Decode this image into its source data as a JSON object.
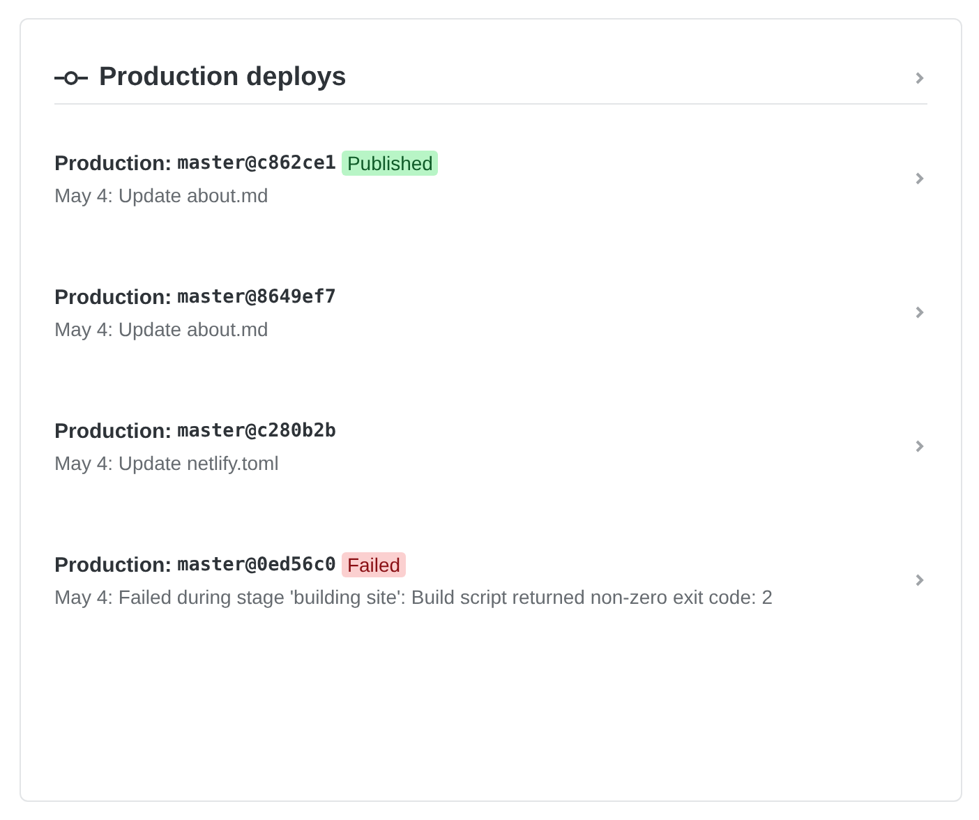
{
  "card": {
    "title": "Production deploys"
  },
  "deploys": [
    {
      "label": "Production:",
      "ref": "master@c862ce1",
      "badge": {
        "text": "Published",
        "kind": "success"
      },
      "description": "May 4: Update about.md"
    },
    {
      "label": "Production:",
      "ref": "master@8649ef7",
      "description": "May 4: Update about.md"
    },
    {
      "label": "Production:",
      "ref": "master@c280b2b",
      "description": "May 4: Update netlify.toml"
    },
    {
      "label": "Production:",
      "ref": "master@0ed56c0",
      "badge": {
        "text": "Failed",
        "kind": "error"
      },
      "description": "May 4: Failed during stage 'building site': Build script returned non-zero exit code: 2"
    }
  ]
}
